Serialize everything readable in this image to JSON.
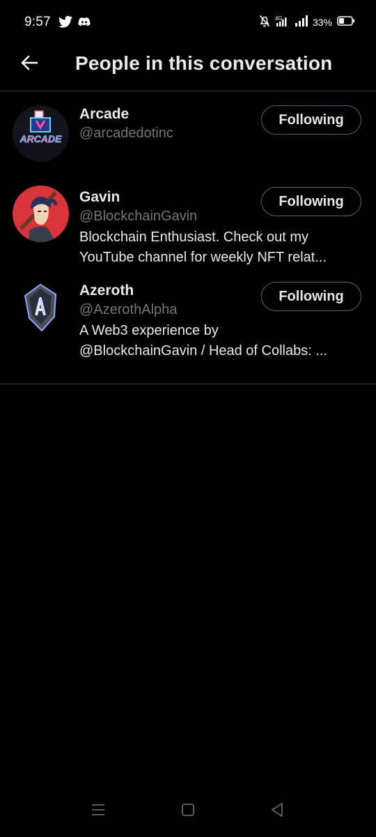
{
  "status_bar": {
    "time": "9:57",
    "battery": "33%",
    "network": "4G",
    "icons": [
      "twitter-icon",
      "discord-icon",
      "mute-icon",
      "network-4g-icon",
      "signal-icon",
      "battery-icon"
    ]
  },
  "header": {
    "back_icon": "arrow-left-icon",
    "title": "People in this conversation"
  },
  "people": [
    {
      "name": "Arcade",
      "handle": "@arcadedotinc",
      "avatar_text": "ARCADE",
      "bio": [],
      "button_label": "Following"
    },
    {
      "name": "Gavin",
      "handle": "@BlockchainGavin",
      "bio": [
        "Blockchain Enthusiast. Check out my",
        "YouTube channel for weekly NFT relat..."
      ],
      "button_label": "Following"
    },
    {
      "name": "Azeroth",
      "handle": "@AzerothAlpha",
      "bio": [
        "A Web3 experience by",
        "@BlockchainGavin / Head of Collabs: ..."
      ],
      "button_label": "Following"
    }
  ],
  "nav_bar": {
    "icons": [
      "menu-icon",
      "home-square-icon",
      "back-triangle-icon"
    ]
  },
  "colors": {
    "background": "#000000",
    "primary_text": "#e7e9ea",
    "secondary_text": "#71767b",
    "divider": "#2f3336",
    "button_border": "#536471"
  }
}
